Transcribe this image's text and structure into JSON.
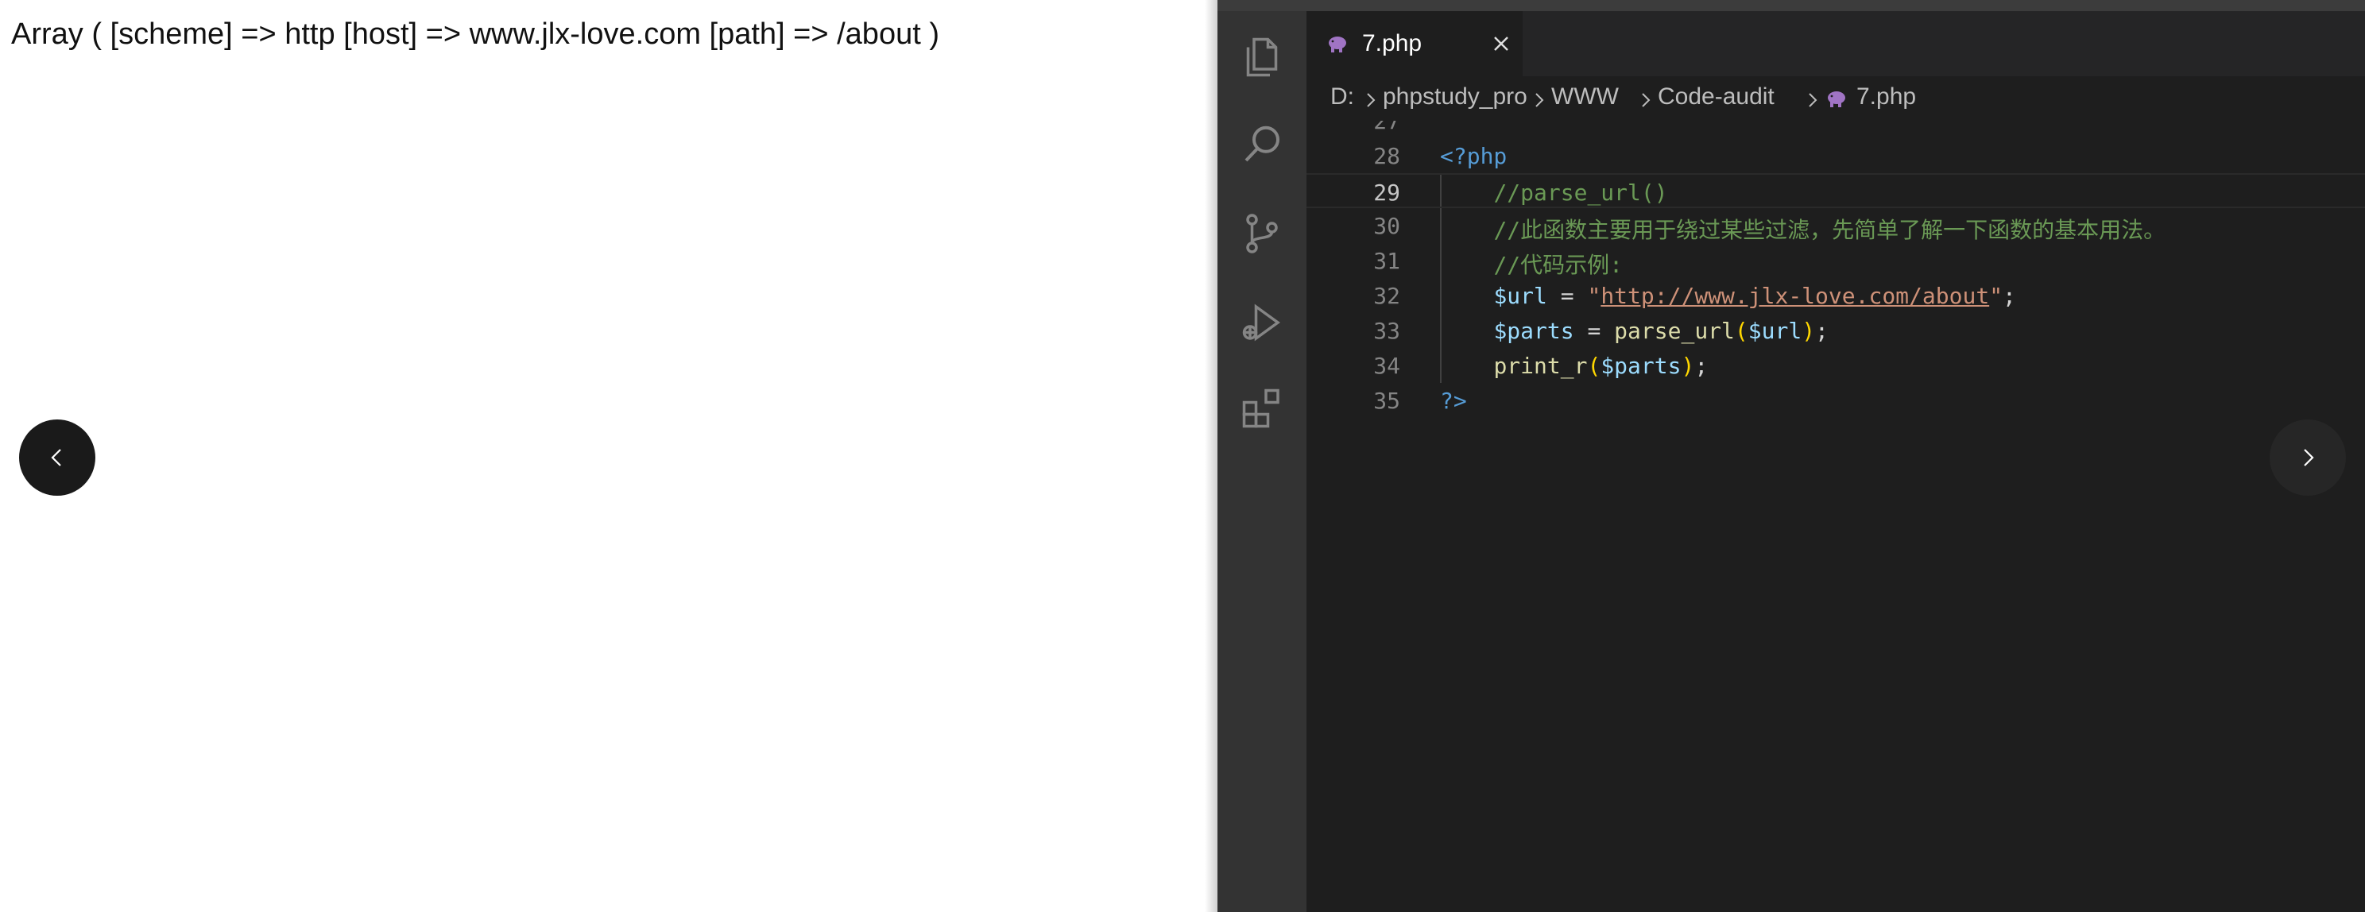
{
  "output": {
    "text": "Array ( [scheme] => http [host] => www.jlx-love.com [path] => /about )"
  },
  "activity_bar": {
    "icons": [
      "files-icon",
      "search-icon",
      "source-control-icon",
      "run-debug-icon",
      "extensions-icon"
    ]
  },
  "tab": {
    "label": "7.php",
    "icon": "php-elephant-icon"
  },
  "breadcrumb": {
    "items": [
      "D:",
      "phpstudy_pro",
      "WWW",
      "Code-audit",
      "7.php"
    ]
  },
  "code": {
    "current_line": 29,
    "lines": [
      {
        "n": "27",
        "segments": []
      },
      {
        "n": "28",
        "segments": [
          {
            "t": "kw",
            "v": "<?php"
          }
        ]
      },
      {
        "n": "29",
        "segments": [
          {
            "t": "pl",
            "v": "    "
          },
          {
            "t": "cm",
            "v": "//parse_url()"
          }
        ]
      },
      {
        "n": "30",
        "segments": [
          {
            "t": "pl",
            "v": "    "
          },
          {
            "t": "cm",
            "v": "//此函数主要用于绕过某些过滤，先简单了解一下函数的基本用法。"
          }
        ]
      },
      {
        "n": "31",
        "segments": [
          {
            "t": "pl",
            "v": "    "
          },
          {
            "t": "cm",
            "v": "//代码示例:"
          }
        ]
      },
      {
        "n": "32",
        "segments": [
          {
            "t": "pl",
            "v": "    "
          },
          {
            "t": "var",
            "v": "$url"
          },
          {
            "t": "pl",
            "v": " = "
          },
          {
            "t": "str",
            "v": "\""
          },
          {
            "t": "url",
            "v": "http://www.jlx-love.com/about"
          },
          {
            "t": "str",
            "v": "\""
          },
          {
            "t": "pl",
            "v": ";"
          }
        ]
      },
      {
        "n": "33",
        "segments": [
          {
            "t": "pl",
            "v": "    "
          },
          {
            "t": "var",
            "v": "$parts"
          },
          {
            "t": "pl",
            "v": " = "
          },
          {
            "t": "fn",
            "v": "parse_url"
          },
          {
            "t": "br",
            "v": "("
          },
          {
            "t": "var",
            "v": "$url"
          },
          {
            "t": "br",
            "v": ")"
          },
          {
            "t": "pl",
            "v": ";"
          }
        ]
      },
      {
        "n": "34",
        "segments": [
          {
            "t": "pl",
            "v": "    "
          },
          {
            "t": "fn",
            "v": "print_r"
          },
          {
            "t": "br",
            "v": "("
          },
          {
            "t": "var",
            "v": "$parts"
          },
          {
            "t": "br",
            "v": ")"
          },
          {
            "t": "pl",
            "v": ";"
          }
        ]
      },
      {
        "n": "35",
        "segments": [
          {
            "t": "kw",
            "v": "?>"
          }
        ]
      }
    ]
  },
  "nav": {
    "prev_icon": "chevron-left-icon",
    "next_icon": "chevron-right-icon"
  },
  "colors": {
    "keyword": "#569cd6",
    "comment": "#6a9955",
    "variable": "#9cdcfe",
    "string": "#ce9178",
    "function": "#dcdcaa",
    "bracket": "#ffd700",
    "php_icon": "#a074c4"
  }
}
